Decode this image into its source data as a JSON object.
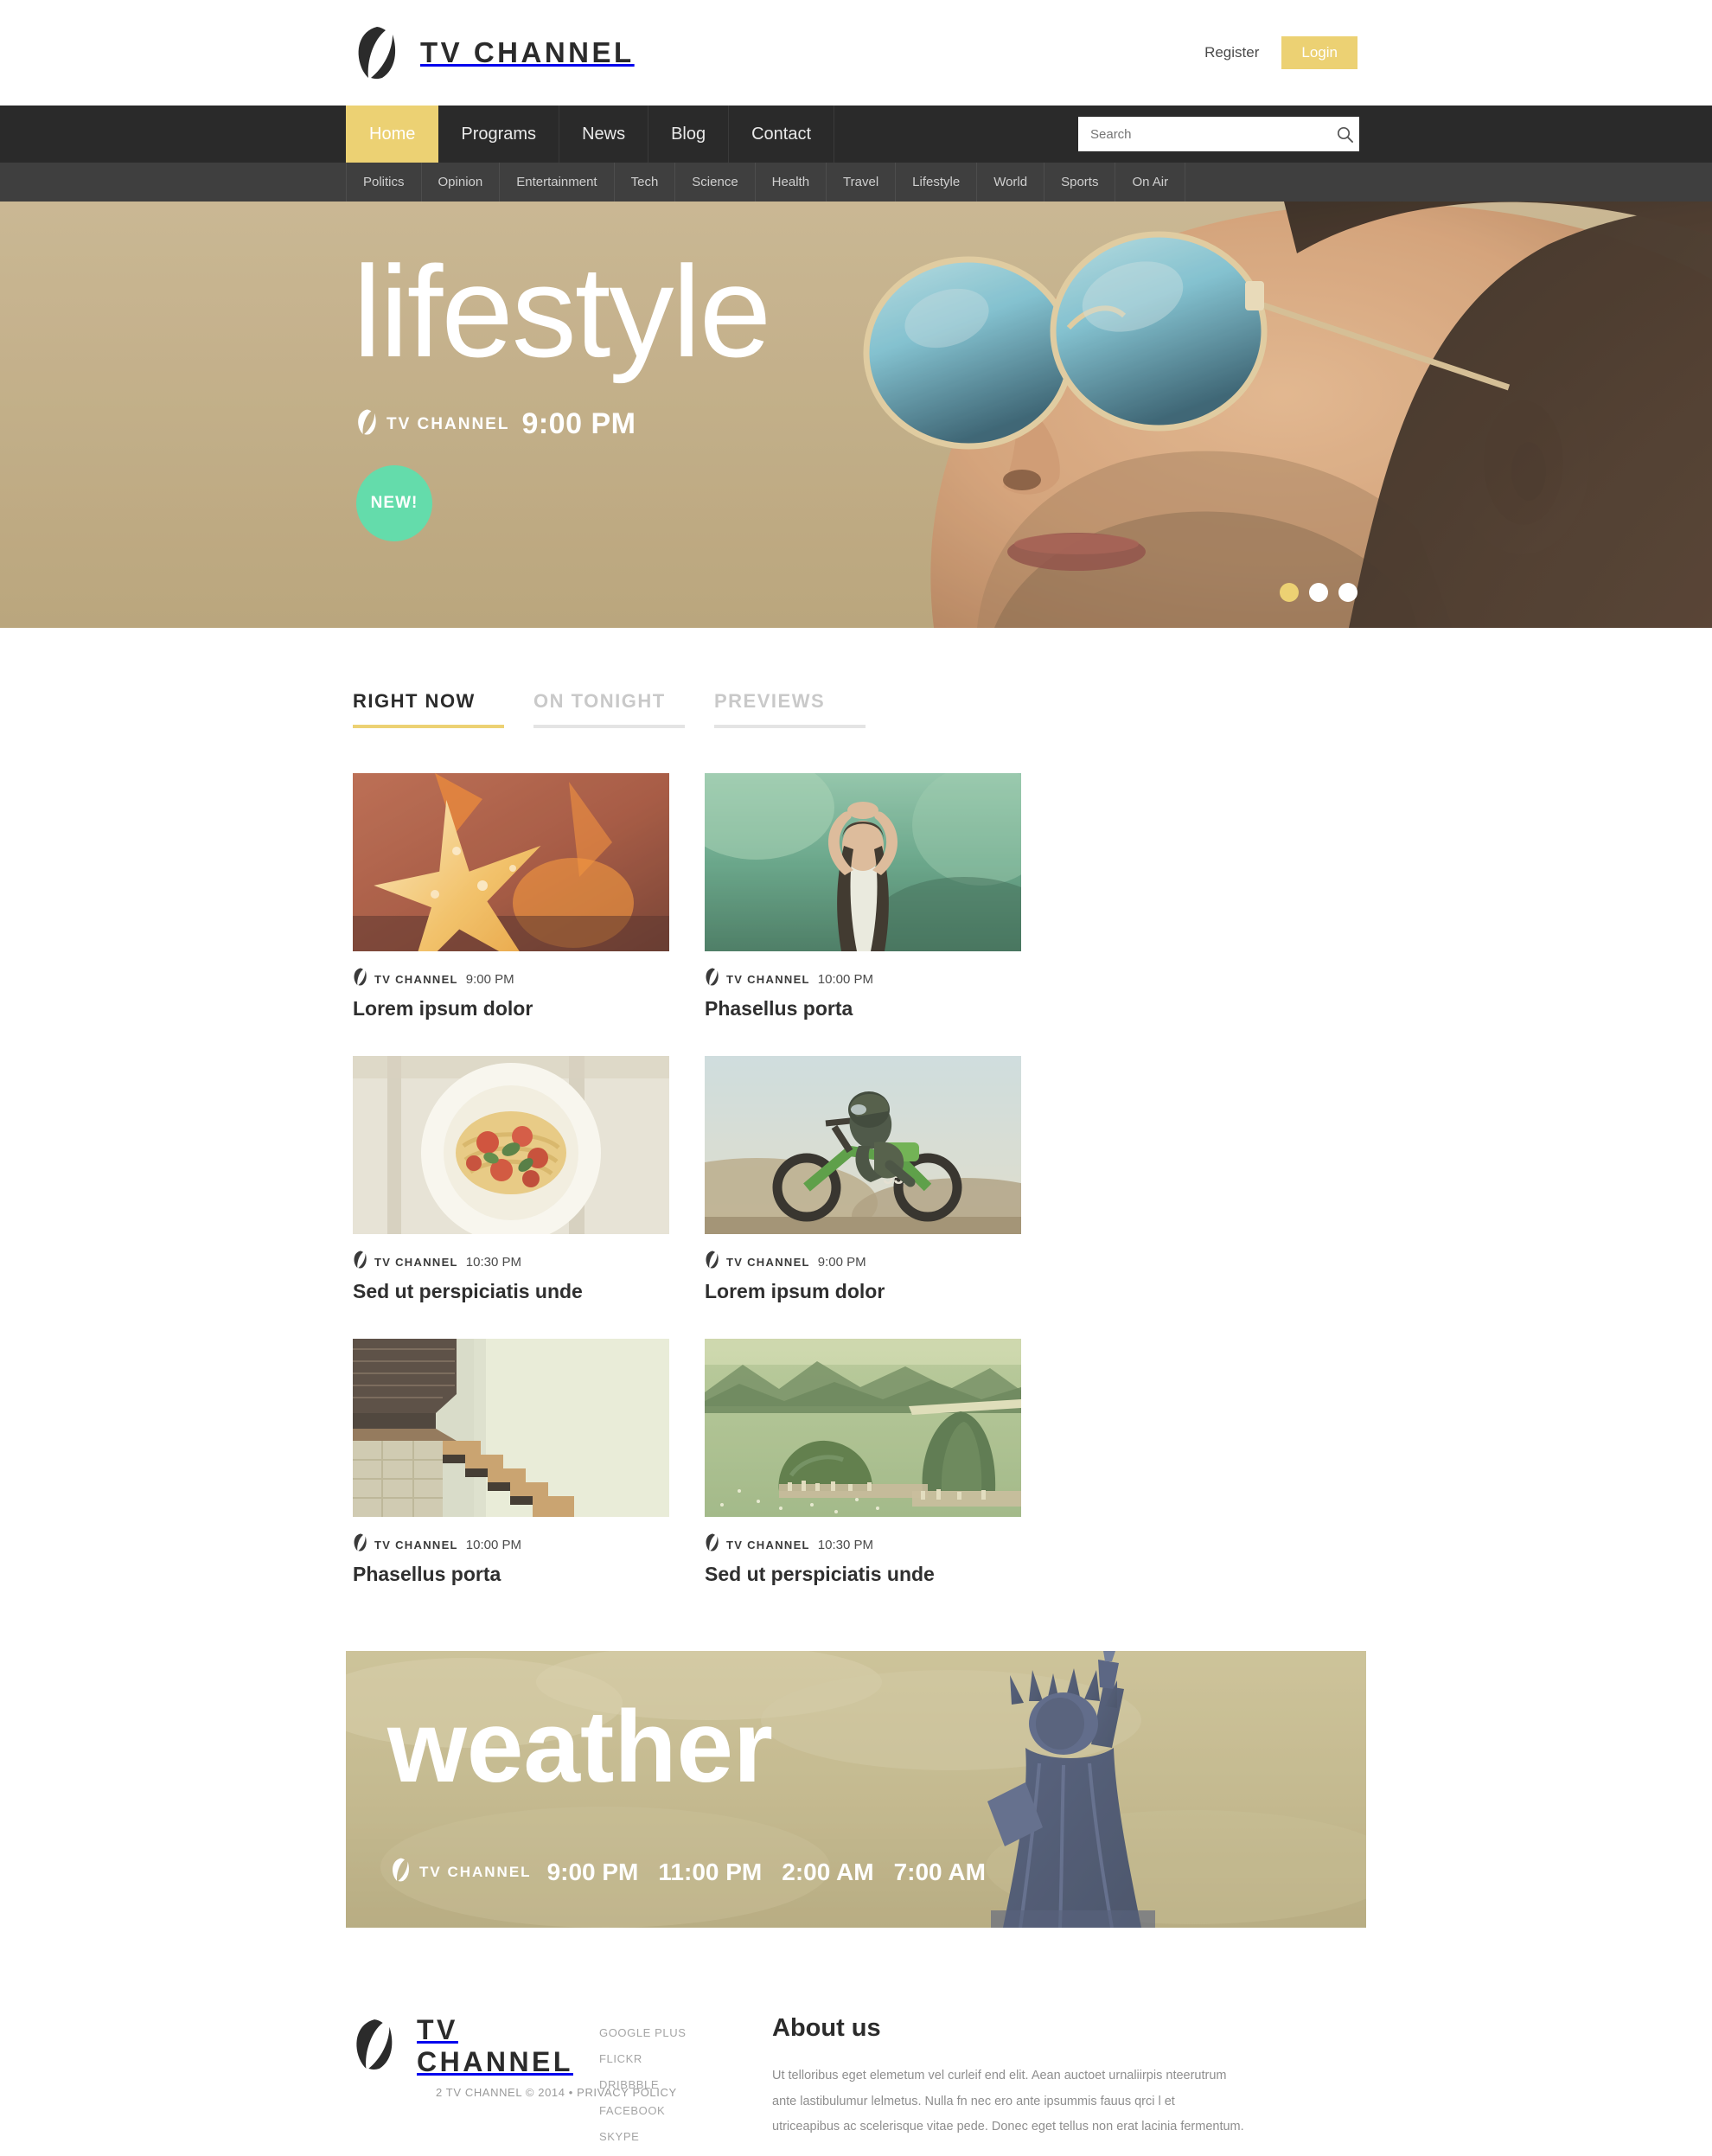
{
  "header": {
    "brand_name": "TV CHANNEL",
    "logo_icon": "tv-channel-leaf-logo",
    "register_label": "Register",
    "login_label": "Login"
  },
  "mainnav": {
    "items": [
      {
        "label": "Home",
        "active": true
      },
      {
        "label": "Programs",
        "active": false
      },
      {
        "label": "News",
        "active": false
      },
      {
        "label": "Blog",
        "active": false
      },
      {
        "label": "Contact",
        "active": false
      }
    ],
    "search": {
      "placeholder": "Search",
      "value": "",
      "icon": "search-icon"
    }
  },
  "subnav": {
    "items": [
      "Politics",
      "Opinion",
      "Entertainment",
      "Tech",
      "Science",
      "Health",
      "Travel",
      "Lifestyle",
      "World",
      "Sports",
      "On Air"
    ]
  },
  "hero": {
    "title": "lifestyle",
    "channel_label": "TV CHANNEL",
    "time": "9:00 PM",
    "badge": "NEW!",
    "slides": [
      {
        "active": true
      },
      {
        "active": false
      },
      {
        "active": false
      }
    ]
  },
  "tabs": [
    {
      "label": "RIGHT NOW",
      "active": true
    },
    {
      "label": "ON TONIGHT",
      "active": false
    },
    {
      "label": "PREVIEWS",
      "active": false
    }
  ],
  "cards": [
    {
      "channel": "TV CHANNEL",
      "time": "9:00 PM",
      "title": "Lorem ipsum dolor",
      "image": "starfish-photo"
    },
    {
      "channel": "TV CHANNEL",
      "time": "10:00 PM",
      "title": "Phasellus porta",
      "image": "yoga-woman-photo"
    },
    {
      "channel": "TV CHANNEL",
      "time": "10:30 PM",
      "title": "Sed ut perspiciatis unde",
      "image": "pasta-plate-photo"
    },
    {
      "channel": "TV CHANNEL",
      "time": "9:00 PM",
      "title": "Lorem ipsum dolor",
      "image": "motocross-photo"
    },
    {
      "channel": "TV CHANNEL",
      "time": "10:00 PM",
      "title": "Phasellus porta",
      "image": "staircase-photo"
    },
    {
      "channel": "TV CHANNEL",
      "time": "10:30 PM",
      "title": "Sed ut perspiciatis unde",
      "image": "rio-bay-photo"
    }
  ],
  "weather": {
    "title": "weather",
    "channel_label": "TV CHANNEL",
    "times": [
      "9:00 PM",
      "11:00 PM",
      "2:00 AM",
      "7:00 AM"
    ],
    "image": "statue-of-liberty-photo"
  },
  "footer": {
    "brand_name": "TV CHANNEL",
    "copyright": "2 TV CHANNEL © 2014 • PRIVACY POLICY",
    "social": [
      "GOOGLE PLUS",
      "FLICKR",
      "DRIBBBLE",
      "FACEBOOK",
      "SKYPE"
    ],
    "about_title": "About us",
    "about_text": "Ut telloribus eget elemetum vel curleif end elit. Aean auctoet urnaliirpis nteerutrum ante lastibulumur lelmetus. Nulla fn nec ero ante ipsummis fauus qrci l et utriceapibus ac scelerisque vitae pede. Donec eget tellus non erat lacinia fermentum."
  },
  "colors": {
    "accent_yellow": "#ecd173",
    "nav_dark": "#2a2a2a",
    "subnav_dark": "#3f3f3f",
    "badge_green": "#64dcab"
  }
}
